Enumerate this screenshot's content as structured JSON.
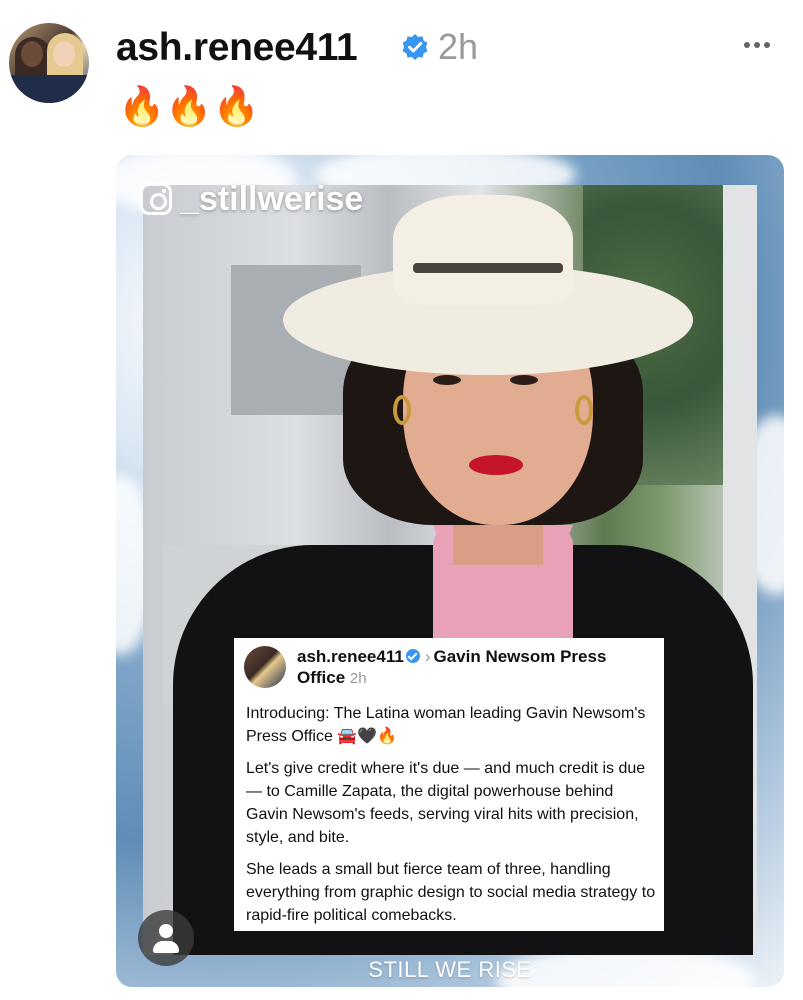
{
  "post": {
    "username": "ash.renee411",
    "time": "2h",
    "caption": "🔥🔥🔥"
  },
  "media": {
    "watermark": "_stillwerise",
    "footer": "STILL WE RISE",
    "card": {
      "username": "ash.renee411",
      "arrow": "›",
      "target": "Gavin Newsom Press Office",
      "time": "2h",
      "paragraphs": [
        "Introducing: The Latina woman leading Gavin Newsom's Press Office 🚘🖤🔥",
        "Let's give credit where it's due — and much credit is due — to Camille Zapata, the digital powerhouse behind Gavin Newsom's feeds, serving viral hits with precision, style, and bite.",
        "She leads a small but fierce team of three, handling everything from graphic design to social media strategy to rapid-fire political comebacks."
      ]
    }
  },
  "colors": {
    "verified": "#3797f0",
    "muted": "#9a9a9a"
  }
}
